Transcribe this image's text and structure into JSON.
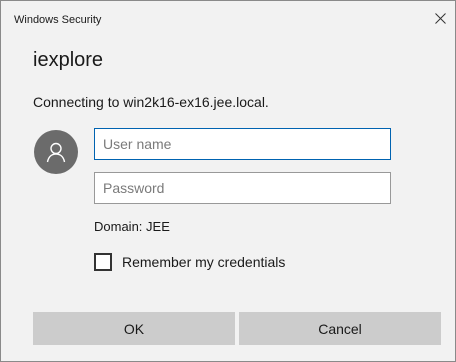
{
  "dialog": {
    "window_title": "Windows Security",
    "app_title": "iexplore",
    "message": "Connecting to win2k16-ex16.jee.local.",
    "close_icon": "close-icon",
    "avatar_icon": "user-avatar-icon"
  },
  "form": {
    "username": {
      "placeholder": "User name",
      "value": ""
    },
    "password": {
      "placeholder": "Password",
      "value": ""
    },
    "domain": "Domain: JEE",
    "remember": {
      "label": "Remember my credentials",
      "checked": false
    }
  },
  "buttons": {
    "ok": "OK",
    "cancel": "Cancel"
  },
  "colors": {
    "background": "#f2f2f2",
    "focus_border": "#0063b1",
    "avatar": "#6b6b6b",
    "button": "#cccccc"
  }
}
